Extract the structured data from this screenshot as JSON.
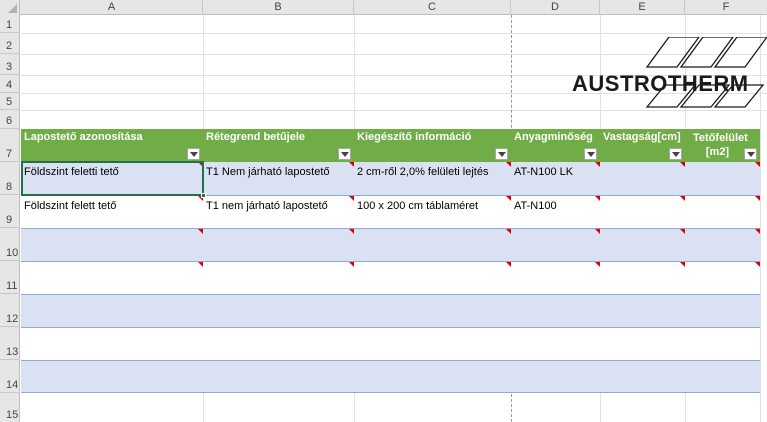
{
  "columns": [
    "A",
    "B",
    "C",
    "D",
    "E",
    "F"
  ],
  "rows": [
    "1",
    "2",
    "3",
    "4",
    "5",
    "6",
    "7",
    "8",
    "9",
    "10",
    "11",
    "12",
    "13",
    "14",
    "15"
  ],
  "logo": {
    "text": "AUSTROTHERM"
  },
  "table": {
    "headers": [
      "Lapostető azonosítása",
      "Rétegrend betűjele",
      "Kiegészítő információ",
      "Anyagminőség",
      "Vastagság[cm]",
      "Tetőfelület [m2]"
    ],
    "rows": [
      [
        "Földszint feletti tető",
        "T1 Nem járható lapostető",
        "2 cm-ről 2,0% felületi lejtés",
        "AT-N100 LK",
        "",
        ""
      ],
      [
        "Földszint felett tető",
        "T1 nem járható lapostető",
        "100 x 200 cm táblaméret",
        "AT-N100",
        "",
        ""
      ]
    ]
  },
  "colors": {
    "header_green": "#70ad47",
    "band_blue": "#d9e1f2",
    "selection_green": "#217346",
    "comment_red": "#e00000"
  }
}
